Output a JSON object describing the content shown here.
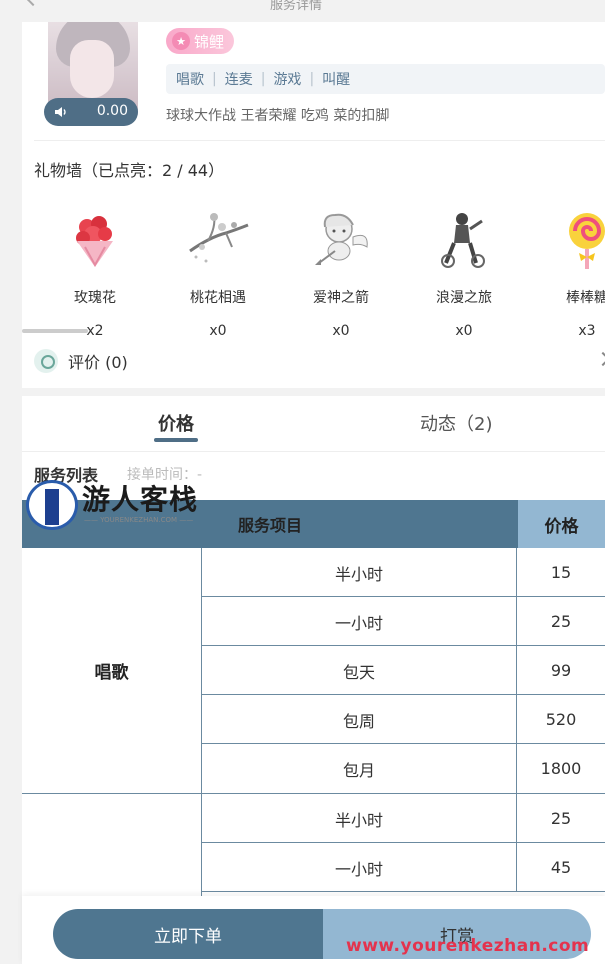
{
  "header": {
    "title": "服务详情"
  },
  "profile": {
    "voice_duration": "0.00",
    "badge_label": "锦鲤",
    "tags": [
      "唱歌",
      "连麦",
      "游戏",
      "叫醒"
    ],
    "games": "球球大作战 王者荣耀 吃鸡 菜的扣脚"
  },
  "gift_wall": {
    "title": "礼物墙（已点亮：2 / 44）",
    "gifts": [
      {
        "name": "玫瑰花",
        "count": "x2",
        "icon": "rose-bouquet-icon"
      },
      {
        "name": "桃花相遇",
        "count": "x0",
        "icon": "peach-blossom-icon"
      },
      {
        "name": "爱神之箭",
        "count": "x0",
        "icon": "cupid-icon"
      },
      {
        "name": "浪漫之旅",
        "count": "x0",
        "icon": "romantic-trip-icon"
      },
      {
        "name": "棒棒糖",
        "count": "x3",
        "icon": "lollipop-icon"
      }
    ]
  },
  "rating": {
    "label": "评价 (0)"
  },
  "tabs": [
    {
      "label": "价格",
      "active": true
    },
    {
      "label": "动态（2)",
      "active": false
    }
  ],
  "service": {
    "heading": "服务列表",
    "order_time": "接单时间：-",
    "table": {
      "col_item": "服务项目",
      "col_price": "价格",
      "groups": [
        {
          "name": "唱歌",
          "rows": [
            {
              "duration": "半小时",
              "price": "15"
            },
            {
              "duration": "一小时",
              "price": "25"
            },
            {
              "duration": "包天",
              "price": "99"
            },
            {
              "duration": "包周",
              "price": "520"
            },
            {
              "duration": "包月",
              "price": "1800"
            }
          ]
        },
        {
          "name": "",
          "rows": [
            {
              "duration": "半小时",
              "price": "25"
            },
            {
              "duration": "一小时",
              "price": "45"
            }
          ]
        }
      ]
    }
  },
  "watermark": {
    "name": "游人客栈",
    "sub": "—— YOURENKEZHAN.COM ——",
    "url": "www.yourenkezhan.com"
  },
  "actions": {
    "order_label": "立即下单",
    "tip_label": "打赏"
  },
  "colors": {
    "primary": "#4f7690",
    "secondary": "#93b7d2",
    "badge": "#f9a8c9"
  }
}
